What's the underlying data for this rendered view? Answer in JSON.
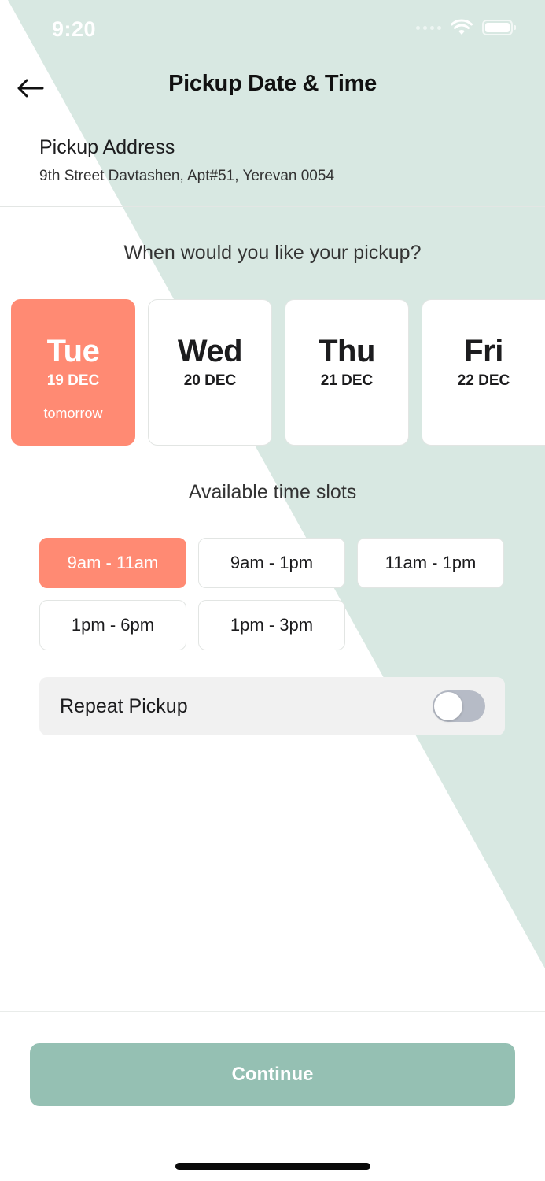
{
  "status_bar": {
    "time": "9:20"
  },
  "header": {
    "title": "Pickup Date & Time",
    "back_icon": "arrow-left-icon"
  },
  "address": {
    "label": "Pickup Address",
    "value": "9th Street Davtashen, Apt#51, Yerevan 0054"
  },
  "question": "When would you like your pickup?",
  "days": [
    {
      "day": "Tue",
      "date": "19 DEC",
      "note": "tomorrow",
      "selected": true
    },
    {
      "day": "Wed",
      "date": "20 DEC",
      "note": "",
      "selected": false
    },
    {
      "day": "Thu",
      "date": "21 DEC",
      "note": "",
      "selected": false
    },
    {
      "day": "Fri",
      "date": "22 DEC",
      "note": "",
      "selected": false
    }
  ],
  "slots_title": "Available time slots",
  "slots": [
    {
      "label": "9am - 11am",
      "selected": true
    },
    {
      "label": "9am - 1pm",
      "selected": false
    },
    {
      "label": "11am - 1pm",
      "selected": false
    },
    {
      "label": "1pm - 6pm",
      "selected": false
    },
    {
      "label": "1pm - 3pm",
      "selected": false
    }
  ],
  "repeat": {
    "label": "Repeat Pickup",
    "enabled": false
  },
  "continue_label": "Continue",
  "colors": {
    "accent": "#ff8a73",
    "primary_button": "#95c0b3",
    "background_shape": "#d8e8e2"
  }
}
